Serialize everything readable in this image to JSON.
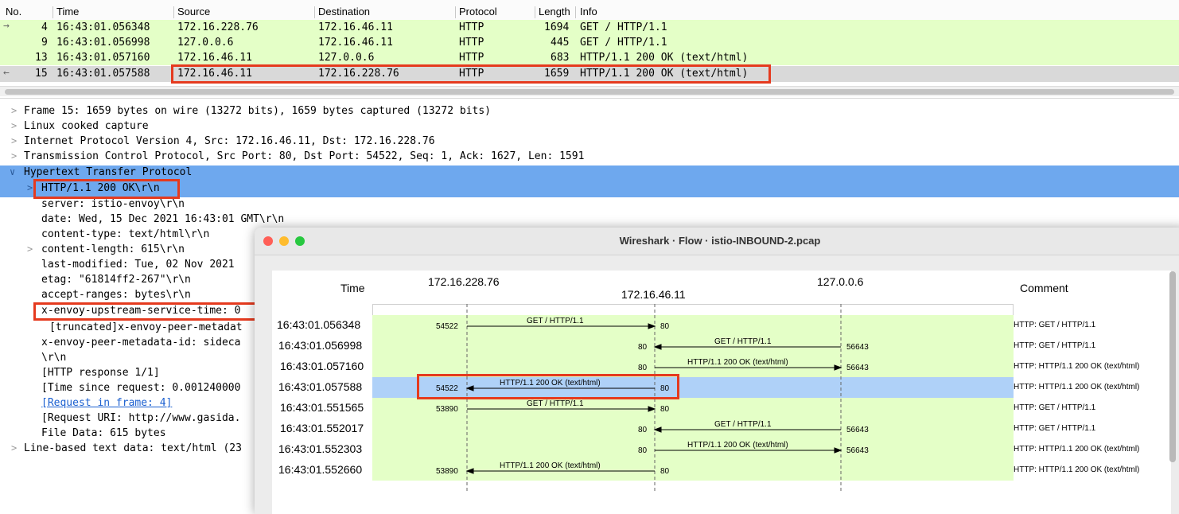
{
  "packet_list": {
    "columns": [
      "No.",
      "Time",
      "Source",
      "Destination",
      "Protocol",
      "Length",
      "Info"
    ],
    "rows": [
      {
        "no": "4",
        "time": "16:43:01.056348",
        "src": "172.16.228.76",
        "dst": "172.16.46.11",
        "proto": "HTTP",
        "len": "1694",
        "info": "GET / HTTP/1.1"
      },
      {
        "no": "9",
        "time": "16:43:01.056998",
        "src": "127.0.0.6",
        "dst": "172.16.46.11",
        "proto": "HTTP",
        "len": "445",
        "info": "GET / HTTP/1.1"
      },
      {
        "no": "13",
        "time": "16:43:01.057160",
        "src": "172.16.46.11",
        "dst": "127.0.0.6",
        "proto": "HTTP",
        "len": "683",
        "info": "HTTP/1.1 200 OK  (text/html)"
      },
      {
        "no": "15",
        "time": "16:43:01.057588",
        "src": "172.16.46.11",
        "dst": "172.16.228.76",
        "proto": "HTTP",
        "len": "1659",
        "info": "HTTP/1.1 200 OK  (text/html)"
      }
    ],
    "colors": {
      "http_row": "#e4ffc7",
      "selected_row": "#d9d9d9",
      "highlight_box": "#e53a1e"
    }
  },
  "details": {
    "lines": [
      "Frame 15: 1659 bytes on wire (13272 bits), 1659 bytes captured (13272 bits)",
      "Linux cooked capture",
      "Internet Protocol Version 4, Src: 172.16.46.11, Dst: 172.16.228.76",
      "Transmission Control Protocol, Src Port: 80, Dst Port: 54522, Seq: 1, Ack: 1627, Len: 1591",
      "Hypertext Transfer Protocol",
      "HTTP/1.1 200 OK\\r\\n",
      "server: istio-envoy\\r\\n",
      "date: Wed, 15 Dec 2021 16:43:01 GMT\\r\\n",
      "content-type: text/html\\r\\n",
      "content-length: 615\\r\\n",
      "last-modified: Tue, 02 Nov 2021",
      "etag: \"61814ff2-267\"\\r\\n",
      "accept-ranges: bytes\\r\\n",
      "x-envoy-upstream-service-time: 0",
      "[truncated]x-envoy-peer-metadat",
      "x-envoy-peer-metadata-id: sideca",
      "\\r\\n",
      "[HTTP response 1/1]",
      "[Time since request: 0.001240000",
      "[Request in frame: 4]",
      "[Request URI: http://www.gasida.",
      "File Data: 615 bytes",
      "Line-based text data: text/html (23"
    ],
    "highlight_color": "#6ea8ee"
  },
  "flow": {
    "window_title": "Wireshark · Flow · istio-INBOUND-2.pcap",
    "headers": {
      "time": "Time",
      "host1": "172.16.228.76",
      "host2": "172.16.46.11",
      "host3": "127.0.0.6",
      "comment": "Comment"
    },
    "rows": [
      {
        "time": "16:43:01.056348",
        "label": "GET / HTTP/1.1",
        "lport": "54522",
        "rport": "80",
        "comment": "HTTP: GET / HTTP/1.1"
      },
      {
        "time": "16:43:01.056998",
        "label": "GET / HTTP/1.1",
        "lport": "80",
        "rport": "56643",
        "comment": "HTTP: GET / HTTP/1.1"
      },
      {
        "time": "16:43:01.057160",
        "label": "HTTP/1.1 200 OK  (text/html)",
        "lport": "80",
        "rport": "56643",
        "comment": "HTTP: HTTP/1.1 200 OK  (text/html)"
      },
      {
        "time": "16:43:01.057588",
        "label": "HTTP/1.1 200 OK  (text/html)",
        "lport": "54522",
        "rport": "80",
        "comment": "HTTP: HTTP/1.1 200 OK  (text/html)"
      },
      {
        "time": "16:43:01.551565",
        "label": "GET / HTTP/1.1",
        "lport": "53890",
        "rport": "80",
        "comment": "HTTP: GET / HTTP/1.1"
      },
      {
        "time": "16:43:01.552017",
        "label": "GET / HTTP/1.1",
        "lport": "80",
        "rport": "56643",
        "comment": "HTTP: GET / HTTP/1.1"
      },
      {
        "time": "16:43:01.552303",
        "label": "HTTP/1.1 200 OK  (text/html)",
        "lport": "80",
        "rport": "56643",
        "comment": "HTTP: HTTP/1.1 200 OK  (text/html)"
      },
      {
        "time": "16:43:01.552660",
        "label": "HTTP/1.1 200 OK  (text/html)",
        "lport": "53890",
        "rport": "80",
        "comment": "HTTP: HTTP/1.1 200 OK  (text/html)"
      }
    ],
    "colors": {
      "flow_bg": "#e4ffc7",
      "selected_bg": "#afd1f8"
    }
  }
}
